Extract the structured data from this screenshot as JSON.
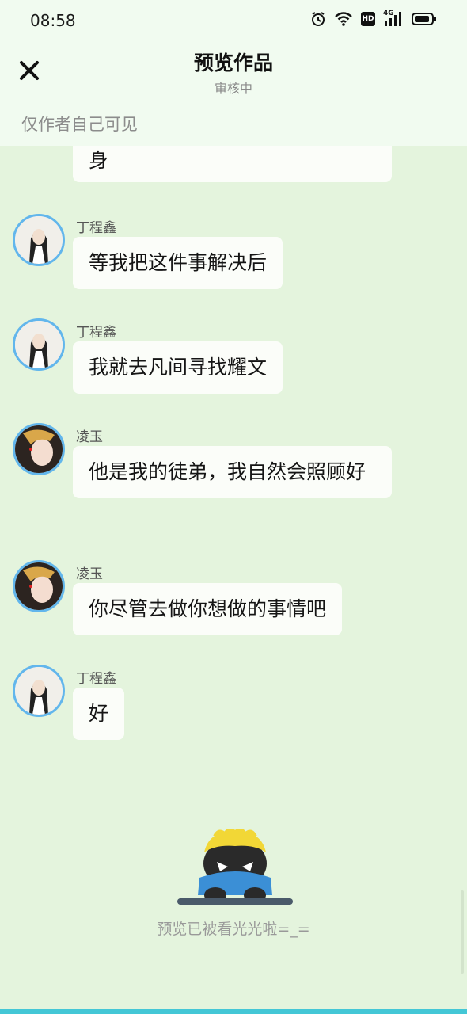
{
  "status_bar": {
    "time": "08:58",
    "network_label": "4G",
    "hd_label": "HD"
  },
  "header": {
    "title": "预览作品",
    "subtitle": "审核中",
    "visibility_note": "仅作者自己可见",
    "close_icon": "close-icon"
  },
  "messages": [
    {
      "text": "身"
    },
    {
      "sender": "丁程鑫",
      "avatar": "avatar-dingchengxin",
      "text": "等我把这件事解决后"
    },
    {
      "sender": "丁程鑫",
      "avatar": "avatar-dingchengxin",
      "text": "我就去凡间寻找耀文"
    },
    {
      "sender": "凌玉",
      "avatar": "avatar-lingyu",
      "text": "他是我的徒弟，我自然会照顾好"
    },
    {
      "sender": "凌玉",
      "avatar": "avatar-lingyu",
      "text": "你尽管去做你想做的事情吧"
    },
    {
      "sender": "丁程鑫",
      "avatar": "avatar-dingchengxin",
      "text": "好"
    }
  ],
  "footer": {
    "empty_message": "预览已被看光光啦=_="
  },
  "colors": {
    "background": "#e4f4dd",
    "header_bg": "#f1fbf0",
    "bubble": "#fbfdf9",
    "avatar_ring": "#62b6ec",
    "accent_line": "#44c7d6"
  }
}
